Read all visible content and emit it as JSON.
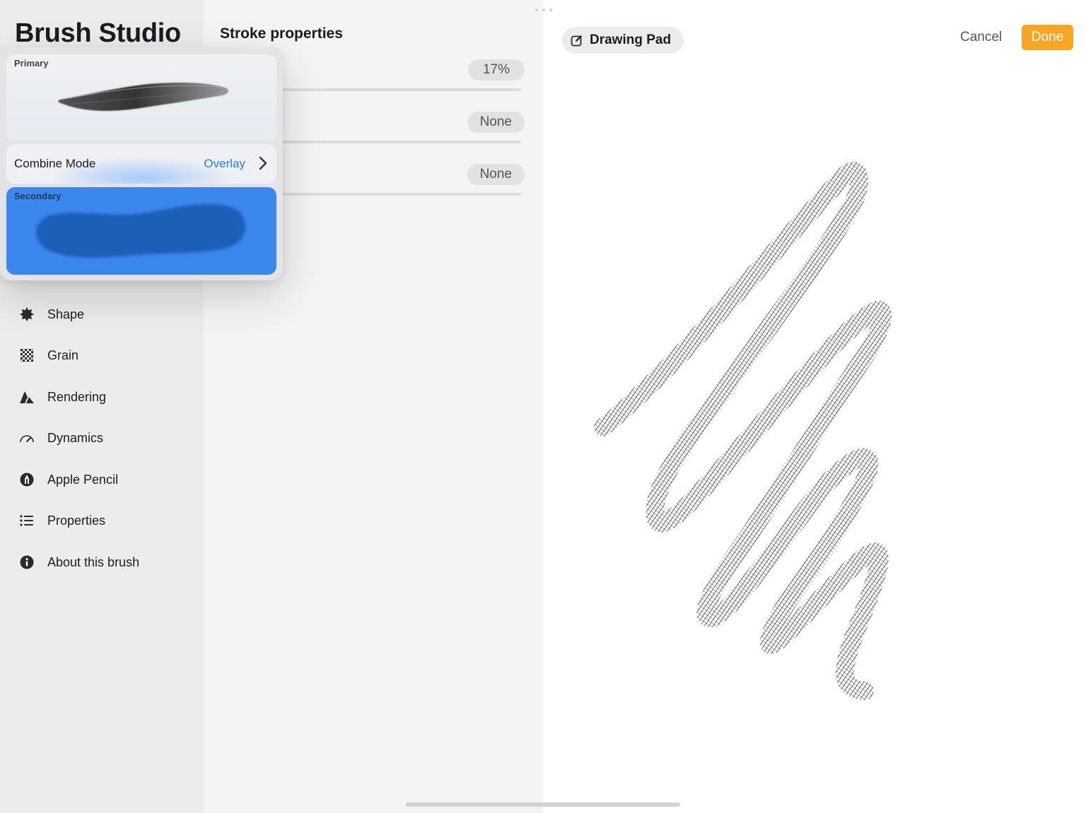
{
  "app": {
    "title": "Brush Studio"
  },
  "sidebar": {
    "items": [
      {
        "label": "Shape",
        "icon": "shape-icon"
      },
      {
        "label": "Grain",
        "icon": "grain-icon"
      },
      {
        "label": "Rendering",
        "icon": "rendering-icon"
      },
      {
        "label": "Dynamics",
        "icon": "dynamics-icon"
      },
      {
        "label": "Apple Pencil",
        "icon": "apple-pencil-icon"
      },
      {
        "label": "Properties",
        "icon": "properties-icon"
      },
      {
        "label": "About this brush",
        "icon": "info-icon"
      }
    ]
  },
  "panel": {
    "title": "Stroke properties",
    "rows": [
      {
        "value": "17%"
      },
      {
        "value": "None"
      },
      {
        "value": "None"
      }
    ]
  },
  "popover": {
    "primary_label": "Primary",
    "combine_mode_label": "Combine Mode",
    "combine_mode_value": "Overlay",
    "secondary_label": "Secondary",
    "secondary_color": "#3b87ee"
  },
  "drawing": {
    "pad_label": "Drawing Pad",
    "cancel_label": "Cancel",
    "done_label": "Done",
    "accent": "#f5a623"
  }
}
